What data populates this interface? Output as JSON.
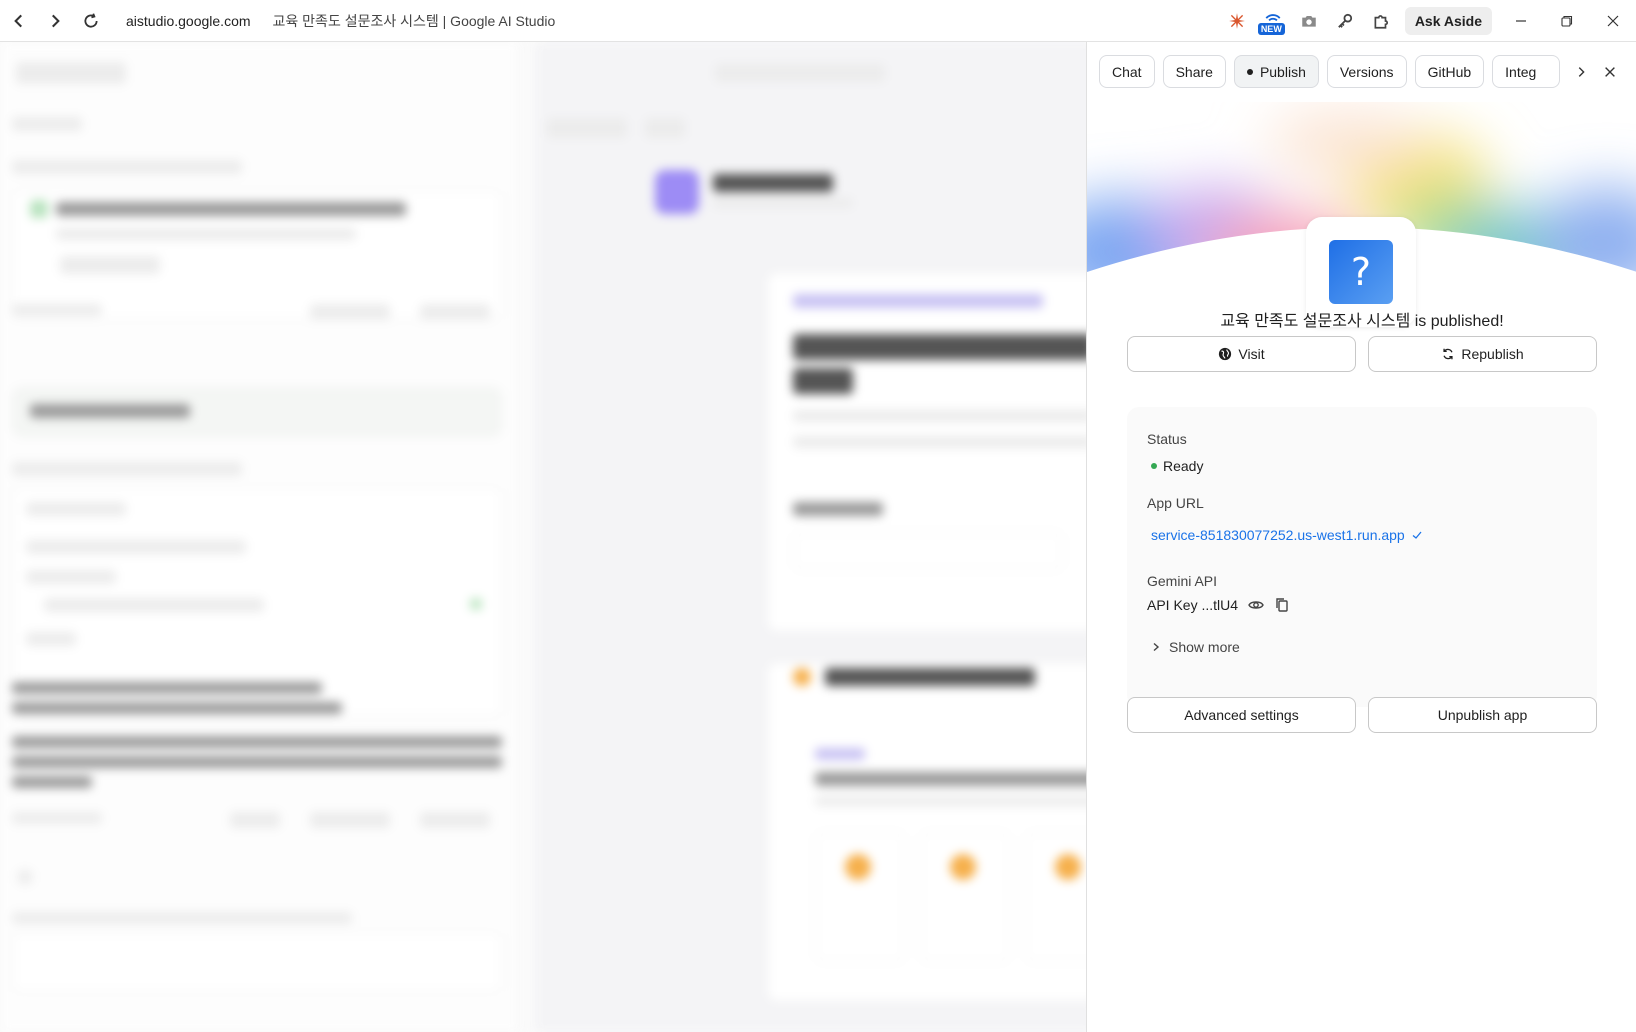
{
  "browser": {
    "url": "aistudio.google.com",
    "page_title": "교육 만족도 설문조사 시스템 | Google AI Studio",
    "new_badge": "NEW",
    "ask_aside": "Ask Aside"
  },
  "panel": {
    "tabs": [
      {
        "label": "Chat"
      },
      {
        "label": "Share"
      },
      {
        "label": "Publish"
      },
      {
        "label": "Versions"
      },
      {
        "label": "GitHub"
      },
      {
        "label": "Integ"
      }
    ],
    "app_icon_glyph": "?",
    "published_message": "교육 만족도 설문조사 시스템 is published!",
    "visit_label": "Visit",
    "republish_label": "Republish",
    "status_label": "Status",
    "status_value": "Ready",
    "app_url_label": "App URL",
    "app_url": "service-851830077252.us-west1.run.app",
    "gemini_api_label": "Gemini API",
    "api_key_text": "API Key ...tlU4",
    "show_more_label": "Show more",
    "advanced_settings_label": "Advanced settings",
    "unpublish_label": "Unpublish app"
  },
  "colors": {
    "link": "#1a73e8",
    "status_ready": "#34a853",
    "icon_blue": "#1f6fe6"
  }
}
